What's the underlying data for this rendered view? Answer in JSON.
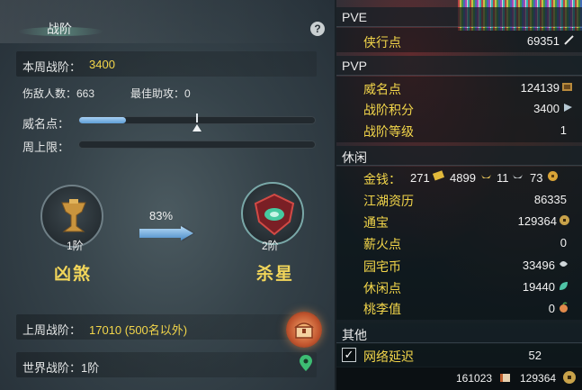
{
  "left": {
    "title": "战阶",
    "help_label": "?",
    "weekly_rank_label": "本周战阶：",
    "weekly_rank_value": "3400",
    "kills_label": "伤敌人数：663",
    "best_assist_label": "最佳助攻：0",
    "fame_label": "威名点：",
    "fame_progress": 0.2,
    "fame_marker": 0.5,
    "weekly_cap_label": "周上限：",
    "weekly_cap_progress": 0,
    "current_tier": "1阶",
    "current_tier_name": "凶煞",
    "progress_percent": "83%",
    "next_tier": "2阶",
    "next_tier_name": "杀星",
    "last_week_label": "上周战阶：",
    "last_week_value": "17010 (500名以外)",
    "world_rank_label": "世界战阶：1阶"
  },
  "right": {
    "pve": {
      "title": "PVE",
      "items": [
        {
          "label": "侠行点",
          "value": "69351"
        }
      ]
    },
    "pvp": {
      "title": "PVP",
      "items": [
        {
          "label": "威名点",
          "value": "124139"
        },
        {
          "label": "战阶积分",
          "value": "3400"
        },
        {
          "label": "战阶等级",
          "value": "1"
        }
      ]
    },
    "leisure": {
      "title": "休闲",
      "money_label": "金钱：",
      "money_gold": "271",
      "money_silver": "4899",
      "money_copper": "11",
      "money_coin": "73",
      "items": [
        {
          "label": "江湖资历",
          "value": "86335"
        },
        {
          "label": "通宝",
          "value": "129364"
        },
        {
          "label": "薪火点",
          "value": "0"
        },
        {
          "label": "园宅币",
          "value": "33496"
        },
        {
          "label": "休闲点",
          "value": "19440"
        },
        {
          "label": "桃李值",
          "value": "0"
        }
      ]
    },
    "other": {
      "title": "其他",
      "latency_label": "网络延迟",
      "latency_value": "52",
      "latency_checked": "✓"
    },
    "bottom": {
      "left_value": "161023",
      "right_value": "129364"
    }
  },
  "colors": {
    "accent_yellow": "#f3d64a",
    "bar_blue": "#5e9ed6"
  }
}
